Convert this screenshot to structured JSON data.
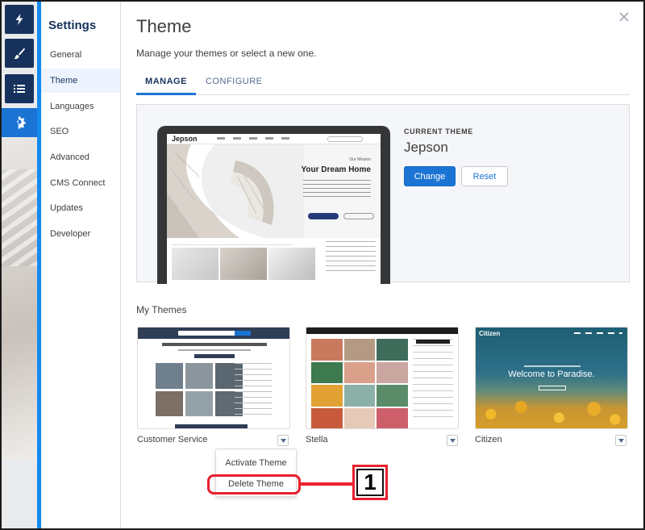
{
  "settings_nav": {
    "title": "Settings",
    "items": [
      {
        "label": "General"
      },
      {
        "label": "Theme",
        "active": true
      },
      {
        "label": "Languages"
      },
      {
        "label": "SEO"
      },
      {
        "label": "Advanced"
      },
      {
        "label": "CMS Connect"
      },
      {
        "label": "Updates"
      },
      {
        "label": "Developer"
      }
    ]
  },
  "rail": {
    "icons": [
      "lightning-icon",
      "paintbrush-icon",
      "list-icon",
      "gear-icon"
    ],
    "active_icon": "gear-icon"
  },
  "header": {
    "title": "Theme",
    "subtitle": "Manage your themes or select a new one.",
    "close_icon": "close-icon"
  },
  "tabs": [
    {
      "label": "MANAGE",
      "active": true
    },
    {
      "label": "CONFIGURE",
      "active": false
    }
  ],
  "current_theme": {
    "label": "CURRENT THEME",
    "name": "Jepson",
    "change_label": "Change",
    "reset_label": "Reset",
    "preview": {
      "logo": "Jepson",
      "tag": "Our Mission",
      "headline": "Your Dream Home"
    }
  },
  "my_themes": {
    "title": "My Themes",
    "cards": [
      {
        "name": "Customer Service"
      },
      {
        "name": "Stella"
      },
      {
        "name": "Citizen",
        "preview_logo": "Citizen",
        "preview_headline": "Welcome to Paradise."
      }
    ]
  },
  "dropdown": {
    "items": [
      {
        "label": "Activate Theme"
      },
      {
        "label": "Delete Theme"
      }
    ]
  },
  "callout": {
    "number": "1"
  },
  "colors": {
    "brand_blue": "#1b74d3",
    "rail_navy": "#16325c",
    "highlight_red": "#e8212e"
  }
}
